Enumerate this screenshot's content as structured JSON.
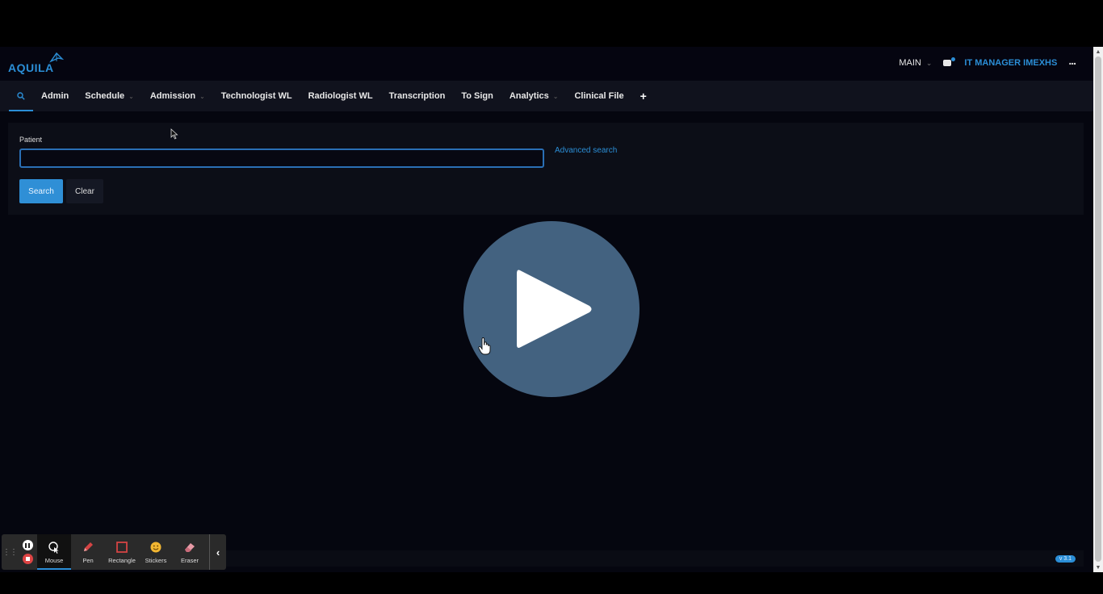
{
  "header": {
    "logo_text": "AQUILA",
    "branch_label": "MAIN",
    "user_name": "IT MANAGER IMEXHS"
  },
  "nav": {
    "items": [
      {
        "label": "Admin",
        "has_dropdown": false
      },
      {
        "label": "Schedule",
        "has_dropdown": true
      },
      {
        "label": "Admission",
        "has_dropdown": true
      },
      {
        "label": "Technologist WL",
        "has_dropdown": false
      },
      {
        "label": "Radiologist WL",
        "has_dropdown": false
      },
      {
        "label": "Transcription",
        "has_dropdown": false
      },
      {
        "label": "To Sign",
        "has_dropdown": false
      },
      {
        "label": "Analytics",
        "has_dropdown": true
      },
      {
        "label": "Clinical File",
        "has_dropdown": false
      }
    ],
    "add_label": "+"
  },
  "search_panel": {
    "patient_label": "Patient",
    "patient_value": "",
    "advanced_search_label": "Advanced search",
    "search_button_label": "Search",
    "clear_button_label": "Clear"
  },
  "footer": {
    "version": "v 3.1"
  },
  "recorder_toolbar": {
    "tools": [
      {
        "label": "Mouse",
        "icon": "mouse-cursor-icon",
        "active": true
      },
      {
        "label": "Pen",
        "icon": "pen-icon",
        "active": false
      },
      {
        "label": "Rectangle",
        "icon": "rectangle-icon",
        "active": false
      },
      {
        "label": "Stickers",
        "icon": "sticker-smiley-icon",
        "active": false
      },
      {
        "label": "Eraser",
        "icon": "eraser-icon",
        "active": false
      }
    ]
  },
  "colors": {
    "accent": "#2b8ed6",
    "background": "#05060f",
    "play_overlay": "#436280",
    "recorder_red": "#d44444"
  }
}
